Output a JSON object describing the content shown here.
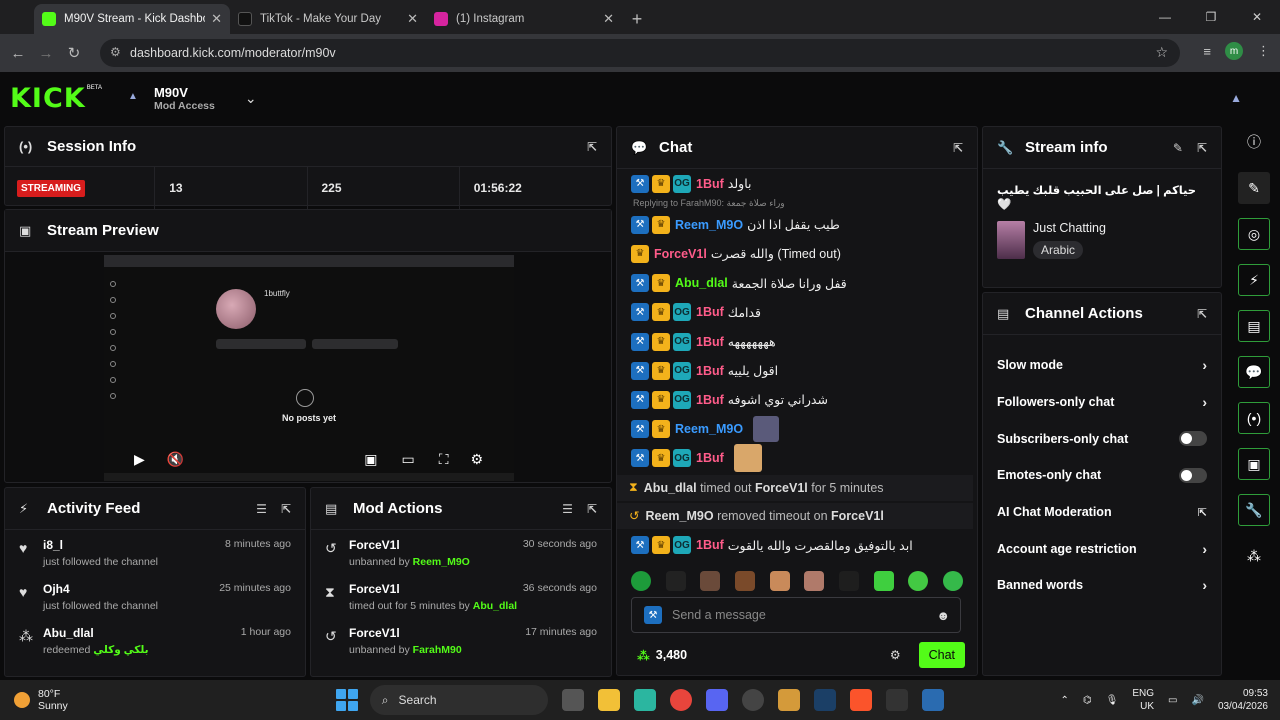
{
  "browser": {
    "tabs": [
      {
        "title": "M90V Stream - Kick Dashboard",
        "color": "#53fc18"
      },
      {
        "title": "TikTok - Make Your Day",
        "color": "#111111"
      },
      {
        "title": "(1) Instagram",
        "color": "#d6249f"
      }
    ],
    "url": "dashboard.kick.com/moderator/m90v",
    "profile_initial": "m"
  },
  "header": {
    "logo": "KICK",
    "beta": "BETA",
    "channel_name": "M90V",
    "channel_sub": "Mod Access"
  },
  "session": {
    "title": "Session Info",
    "status": "STREAMING",
    "stats": [
      "13",
      "225",
      "01:56:22"
    ]
  },
  "preview": {
    "title": "Stream Preview",
    "ig_name": "1buttfly",
    "ig_empty": "No posts yet"
  },
  "activity": {
    "title": "Activity Feed",
    "items": [
      {
        "user": "i8_l",
        "time": "8 minutes ago",
        "desc": "just followed the channel",
        "extra": ""
      },
      {
        "user": "Ojh4",
        "time": "25 minutes ago",
        "desc": "just followed the channel",
        "extra": ""
      },
      {
        "user": "Abu_dlal",
        "time": "1 hour ago",
        "desc": "redeemed",
        "extra": "بلكي وكلي"
      }
    ]
  },
  "modactions": {
    "title": "Mod Actions",
    "items": [
      {
        "user": "ForceV1l",
        "time": "30 seconds ago",
        "desc": "unbanned by",
        "by": "Reem_M9O"
      },
      {
        "user": "ForceV1l",
        "time": "36 seconds ago",
        "desc": "timed out for 5 minutes by",
        "by": "Abu_dlal"
      },
      {
        "user": "ForceV1l",
        "time": "17 minutes ago",
        "desc": "unbanned by",
        "by": "FarahM90"
      }
    ]
  },
  "chat": {
    "title": "Chat",
    "reply_text": "Replying to FarahM90: وراء صلاة جمعة",
    "messages": [
      {
        "user": "1Buf",
        "color": "#ff5c8a",
        "text": "باولد"
      },
      {
        "user": "Reem_M9O",
        "color": "#3a9bff",
        "text": "طيب يقفل اذا اذن"
      },
      {
        "user": "ForceV1l",
        "color": "#ff5c8a",
        "text": "والله قصرت (Timed out)"
      },
      {
        "user": "Abu_dlal",
        "color": "#53fc18",
        "text": "قفل ورانا صلاة الجمعة"
      },
      {
        "user": "1Buf",
        "color": "#ff5c8a",
        "text": "قدامك"
      },
      {
        "user": "1Buf",
        "color": "#ff5c8a",
        "text": "هههههههه"
      },
      {
        "user": "1Buf",
        "color": "#ff5c8a",
        "text": "اقول يلييه"
      },
      {
        "user": "1Buf",
        "color": "#ff5c8a",
        "text": "شدراني توي اشوفه"
      },
      {
        "user": "Reem_M9O",
        "color": "#3a9bff",
        "text": ""
      },
      {
        "user": "1Buf",
        "color": "#ff5c8a",
        "text": ""
      }
    ],
    "system": [
      {
        "actor": "Abu_dlal",
        "action": "timed out",
        "target": "ForceV1l",
        "suffix": "for 5 minutes"
      },
      {
        "actor": "Reem_M9O",
        "action": "removed timeout on",
        "target": "ForceV1l",
        "suffix": ""
      }
    ],
    "last": {
      "user": "1Buf",
      "color": "#ff5c8a",
      "text": "ابد بالتوفيق ومالقصرت والله يالقوت"
    },
    "placeholder": "Send a message",
    "points": "3,480",
    "send_label": "Chat"
  },
  "streaminfo": {
    "title": "Stream info",
    "stream_title": "حياكم | صل على الحبيب قلبك يطيب 🤍",
    "category": "Just Chatting",
    "tag": "Arabic"
  },
  "channel_actions": {
    "title": "Channel Actions",
    "rows": [
      {
        "label": "Slow mode",
        "kind": "chevron"
      },
      {
        "label": "Followers-only chat",
        "kind": "chevron"
      },
      {
        "label": "Subscribers-only chat",
        "kind": "toggle"
      },
      {
        "label": "Emotes-only chat",
        "kind": "toggle"
      },
      {
        "label": "AI Chat Moderation",
        "kind": "external"
      },
      {
        "label": "Account age restriction",
        "kind": "chevron"
      },
      {
        "label": "Banned words",
        "kind": "chevron"
      }
    ]
  },
  "taskbar": {
    "temp": "80°F",
    "cond": "Sunny",
    "search": "Search",
    "lang1": "ENG",
    "lang2": "UK",
    "time": "09:53",
    "date": "03/04/2026"
  },
  "colors": {
    "brand": "#53fc18",
    "live": "#d71d1d"
  }
}
